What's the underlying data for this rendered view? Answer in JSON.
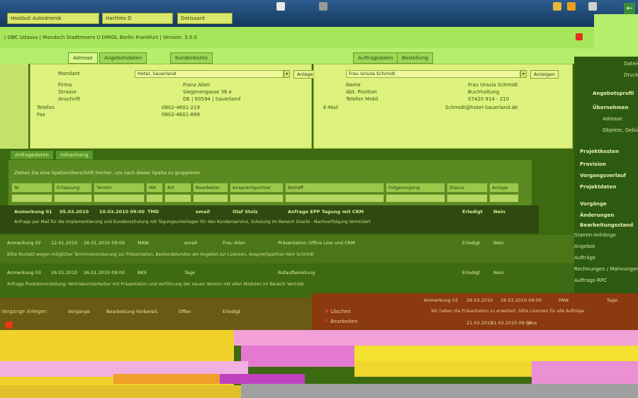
{
  "taskbar": {
    "items": [
      {
        "label": "Hostbuli Autodromik"
      },
      {
        "label": "Hartfoto D"
      },
      {
        "label": "Dotisaard"
      }
    ],
    "right_icon": "back-arrow-icon"
  },
  "window": {
    "title": "/ OBC Udassa | Mandsch Stadtmoers U DMIOL Berlin Frankfurt | Version: 3.0.0"
  },
  "tabs": {
    "top": [
      {
        "label": "Adresse"
      },
      {
        "label": "Angebotsdaten"
      },
      {
        "label": "Kundenkonto"
      },
      {
        "label": "Auftragsdaten"
      },
      {
        "label": "Bestellung"
      }
    ]
  },
  "left_panel": {
    "rows": [
      {
        "label": "Mandant",
        "value": "Hotel, Sauerland"
      },
      {
        "label": "Firma",
        "value": "Franz Allen"
      },
      {
        "label": "Strasse",
        "value": "Siegenergasse 36 e"
      },
      {
        "label": "Anschrift",
        "value": "DE | 60594 | Sauerland"
      },
      {
        "label": "Telefon",
        "value": "0802-4601-219"
      },
      {
        "label": "Fax",
        "value": "0802-4601-899"
      }
    ],
    "button": "Anlegen"
  },
  "right_form": {
    "contact": "Frau Ursula Schmidt",
    "rows": [
      {
        "label": "Name",
        "value": "Frau Ursula Schmidt"
      },
      {
        "label": "Abt. Position",
        "value": "Buchhaltung"
      },
      {
        "label": "Telefon Mobil",
        "value": "07420 914 - 210"
      },
      {
        "label": "E-Mail",
        "value": "Schmidt@hotel-Sauerland.de"
      }
    ],
    "button": "Anzeigen"
  },
  "sidebar": {
    "items": [
      {
        "label": "Dateien"
      },
      {
        "label": "Drucken"
      },
      {
        "label": "Angebotsprofil"
      },
      {
        "label": "Übernehmen"
      },
      {
        "label": "Adresse"
      },
      {
        "label": "Objekte, Gebühren"
      },
      {
        "label": "Projektkosten"
      },
      {
        "label": "Provision"
      },
      {
        "label": "Vorgangsverlauf"
      },
      {
        "label": "Projektdaten"
      },
      {
        "label": "Vorgänge"
      },
      {
        "label": "Änderungen"
      },
      {
        "label": "Bearbeitungsstand"
      },
      {
        "label": "Stamm-Anhänge"
      },
      {
        "label": "Angebot"
      },
      {
        "label": "Aufträge"
      },
      {
        "label": "Rechnungen / Mahnungen"
      },
      {
        "label": "Auftrags-RPC"
      }
    ]
  },
  "subtabs": [
    {
      "label": "Anfragedaten"
    },
    {
      "label": "Infoanhang"
    }
  ],
  "grid": {
    "hint": "Ziehen Sie eine Spaltenüberschrift hierher, um nach dieser Spalte zu gruppieren",
    "columns": [
      "Nr",
      "Erfassung",
      "Termin",
      "MA",
      "Art",
      "Bearbeiter",
      "Ansprechpartner",
      "Betreff",
      "Folgevorgang",
      "Status",
      "Anlage"
    ],
    "rows": [
      {
        "nr": "Anmerkung 01",
        "date": "05.03.2010",
        "time": "10.03.2010 09:00",
        "ma": "TMD",
        "art": "email",
        "person": "Olaf Stolz",
        "subject": "Anfrage EPP Tagung mit CRM",
        "status": "Erledigt",
        "flag": "Nein",
        "desc": "Anfrage per Mail für die Implementierung und Kundenschulung mit Tagungsunterlagen für den Kundenservice, Schulung im Bereich Oracle - Nachverfolgung terminiert"
      },
      {
        "nr": "Anmerkung 02",
        "date": "12.01.2010",
        "time": "26.01.2010 09:00",
        "ma": "MAW",
        "art": "email",
        "person": "Frau Allen",
        "subject": "Präsentation Office Line und CRM",
        "status": "Erledigt",
        "flag": "Nein",
        "desc": "Bitte Kontakt wegen möglicher Terminvereinbarung zur Präsentation, Bestandskunden ein Angebot zur Lizenzen, Ansprechpartner Herr Schmidt"
      },
      {
        "nr": "Anmerkung 03",
        "date": "26.01.2010",
        "time": "26.01.2010 09:00",
        "ma": "BKS",
        "art": "Tage",
        "person": "",
        "subject": "Rufaufbereitung",
        "status": "Erledigt",
        "flag": "Nein",
        "desc": "Anfrage Produktvorstellung: Vertriebsmitarbeiter mit Präsentation und Vorführung der neuen Version mit allen Modulen im Bereich Vertrieb"
      }
    ]
  },
  "bottom": {
    "row1": {
      "label": "Vorgänge",
      "value": "Bearbeitung Vorbereit.",
      "status": "Offen",
      "status2": "Erledigt"
    },
    "menu_items": [
      "Löschen",
      "Bearbeiten"
    ],
    "info_row": {
      "nr": "Anmerkung 03",
      "date": "26.03.2010",
      "time": "26.03.2010 09:00",
      "ma": "PAW",
      "art": "Tage"
    },
    "info_desc": "Wir haben die Präsentation zu erweitert, bitte Lizenzen für alle Aufträge",
    "info_row2": {
      "date": "21.03.2010",
      "time": "21.03.2010 09:00",
      "art": "plus"
    },
    "left_label": "Vorgänge Anlegen"
  },
  "colors": {
    "panel": "#dcf27c",
    "accent": "#e03020",
    "sidebar": "#2d5a12"
  }
}
